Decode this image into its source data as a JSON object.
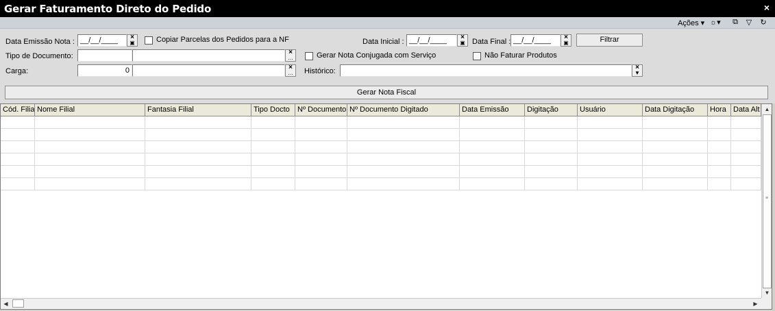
{
  "window": {
    "title": "Gerar Faturamento Direto do Pedido",
    "close_glyph": "×"
  },
  "toolbar": {
    "acoes_label": "Ações",
    "icons": [
      "gear-dropdown-icon",
      "restore-icon",
      "filter-icon",
      "refresh-icon"
    ]
  },
  "form": {
    "data_emissao_label": "Data Emissão Nota :",
    "data_emissao_value": "__/__/____",
    "copiar_parcelas_label": "Copiar Parcelas dos Pedidos para a NF",
    "data_inicial_label": "Data Inicial :",
    "data_inicial_value": "__/__/____",
    "data_final_label": "Data Final :",
    "data_final_value": "__/__/____",
    "filtrar_label": "Filtrar",
    "tipo_documento_label": "Tipo de Documento:",
    "tipo_documento_code": "",
    "tipo_documento_desc": "",
    "gerar_conjugada_label": "Gerar Nota Conjugada com Serviço",
    "nao_faturar_label": "Não Faturar Produtos",
    "carga_label": "Carga:",
    "carga_code": "0",
    "carga_desc": "",
    "historico_label": "Histórico:",
    "historico_value": "",
    "gerar_nota_label": "Gerar Nota Fiscal"
  },
  "grid": {
    "columns": [
      "Cód. Filial",
      "Nome Filial",
      "Fantasia Filial",
      "Tipo Docto",
      "Nº Documento",
      "Nº Documento Digitado",
      "Data Emissão",
      "Digitação",
      "Usuário",
      "Data Digitação",
      "Hora",
      "Data Alt"
    ],
    "rows": [
      [],
      [],
      [],
      [],
      [],
      []
    ]
  },
  "colors": {
    "titlebar_bg": "#000000",
    "header_bg": "#ebe9d9",
    "form_bg": "#dcdcdc"
  }
}
